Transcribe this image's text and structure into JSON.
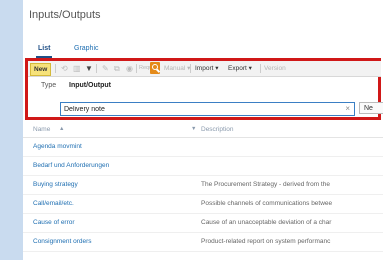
{
  "window": {
    "title": "Inputs/Outputs"
  },
  "tabs": [
    {
      "label": "List",
      "active": true
    },
    {
      "label": "Graphic",
      "active": false
    }
  ],
  "toolbar": {
    "new_label": "New",
    "request_label": "Request",
    "manual_label": "Manual",
    "import_label": "Import",
    "export_label": "Export",
    "version_label": "Version"
  },
  "filter": {
    "type_label": "Type",
    "type_value": "Input/Output",
    "search_value": "Delivery note",
    "clear_icon": "close-icon",
    "next_label": "Ne"
  },
  "table": {
    "columns": [
      "Name",
      "Description"
    ],
    "rows": [
      {
        "name": "Agenda movmint",
        "description": ""
      },
      {
        "name": "Bedarf und Anforderungen",
        "description": ""
      },
      {
        "name": "Buying strategy",
        "description": "The Procurement Strategy - derived from the"
      },
      {
        "name": "Call/email/etc.",
        "description": "Possible channels of communications betwee"
      },
      {
        "name": "Cause of error",
        "description": "Cause of an unacceptable deviation of a char"
      },
      {
        "name": "Consignment orders",
        "description": "Product-related report on system performanc"
      }
    ]
  },
  "colors": {
    "accent": "#1f6fb2",
    "highlight_border": "#d01818",
    "new_button": "#f6e27a",
    "search_button": "#e48a1a",
    "background": "#c9dbef"
  }
}
